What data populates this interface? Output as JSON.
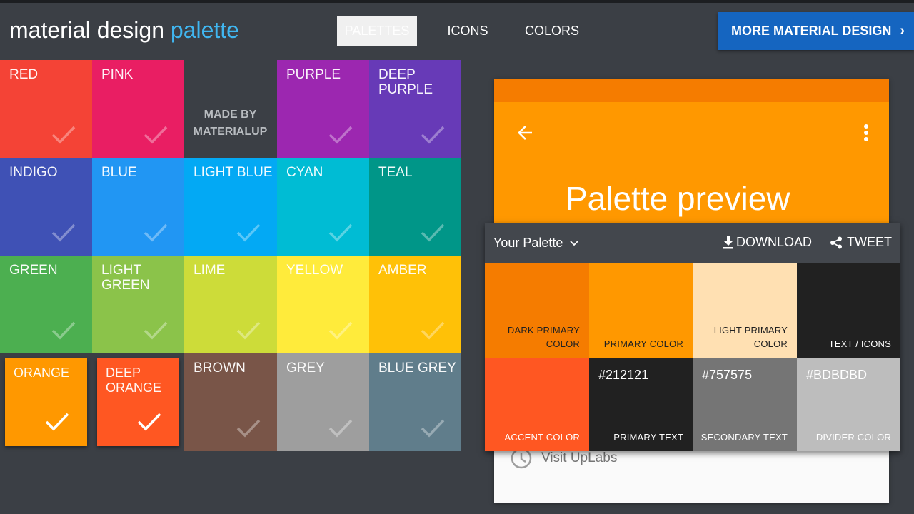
{
  "header": {
    "logo_main": "material design",
    "logo_accent": "palette",
    "tabs": [
      {
        "label": "PALETTES",
        "active": true
      },
      {
        "label": "ICONS",
        "active": false
      },
      {
        "label": "COLORS",
        "active": false
      }
    ],
    "more_label": "MORE MATERIAL DESIGN",
    "more_color": "#1565c0"
  },
  "palette": {
    "made_by_line1": "MADE BY",
    "made_by_line2": "MATERIALUP",
    "colors": [
      {
        "name": "RED",
        "hex": "#f44336",
        "selected": false
      },
      {
        "name": "PINK",
        "hex": "#e91e63",
        "selected": false
      },
      {
        "name": "",
        "hex": "#3b3f45",
        "selected": false
      },
      {
        "name": "PURPLE",
        "hex": "#9c27b0",
        "selected": false
      },
      {
        "name": "DEEP PURPLE",
        "hex": "#673ab7",
        "selected": false
      },
      {
        "name": "INDIGO",
        "hex": "#3f51b5",
        "selected": false
      },
      {
        "name": "BLUE",
        "hex": "#2196f3",
        "selected": false
      },
      {
        "name": "LIGHT BLUE",
        "hex": "#03a9f4",
        "selected": false
      },
      {
        "name": "CYAN",
        "hex": "#00bcd4",
        "selected": false
      },
      {
        "name": "TEAL",
        "hex": "#009688",
        "selected": false
      },
      {
        "name": "GREEN",
        "hex": "#4caf50",
        "selected": false
      },
      {
        "name": "LIGHT GREEN",
        "hex": "#8bc34a",
        "selected": false
      },
      {
        "name": "LIME",
        "hex": "#cddc39",
        "selected": false
      },
      {
        "name": "YELLOW",
        "hex": "#ffeb3b",
        "selected": false
      },
      {
        "name": "AMBER",
        "hex": "#ffc107",
        "selected": false
      },
      {
        "name": "ORANGE",
        "hex": "#ff9800",
        "selected": true
      },
      {
        "name": "DEEP ORANGE",
        "hex": "#ff5722",
        "selected": true
      },
      {
        "name": "BROWN",
        "hex": "#795548",
        "selected": false
      },
      {
        "name": "GREY",
        "hex": "#9e9e9e",
        "selected": false
      },
      {
        "name": "BLUE GREY",
        "hex": "#607d8b",
        "selected": false
      }
    ]
  },
  "preview": {
    "title": "Palette preview",
    "status_color": "#f57c00",
    "appbar_color": "#ff9800",
    "visit_label": "Visit UpLabs"
  },
  "panel": {
    "palette_name": "Your Palette",
    "download_label": "DOWNLOAD",
    "tweet_label": "TWEET",
    "swatches": [
      {
        "label_line1": "DARK PRIMARY",
        "label_line2": "COLOR",
        "hex": "",
        "bg": "#f57c00",
        "fg": "#212121"
      },
      {
        "label_line1": "",
        "label_line2": "PRIMARY COLOR",
        "hex": "",
        "bg": "#ff9800",
        "fg": "#212121"
      },
      {
        "label_line1": "LIGHT PRIMARY",
        "label_line2": "COLOR",
        "hex": "",
        "bg": "#ffe0b2",
        "fg": "#212121"
      },
      {
        "label_line1": "",
        "label_line2": "TEXT / ICONS",
        "hex": "",
        "bg": "#212121",
        "fg": "#ffffff"
      },
      {
        "label_line1": "",
        "label_line2": "ACCENT COLOR",
        "hex": "",
        "bg": "#ff5722",
        "fg": "#ffffff"
      },
      {
        "label_line1": "",
        "label_line2": "PRIMARY TEXT",
        "hex": "#212121",
        "bg": "#212121",
        "fg": "#ffffff"
      },
      {
        "label_line1": "",
        "label_line2": "SECONDARY TEXT",
        "hex": "#757575",
        "bg": "#757575",
        "fg": "#ffffff"
      },
      {
        "label_line1": "",
        "label_line2": "DIVIDER COLOR",
        "hex": "#BDBDBD",
        "bg": "#bdbdbd",
        "fg": "#ffffff"
      }
    ]
  }
}
